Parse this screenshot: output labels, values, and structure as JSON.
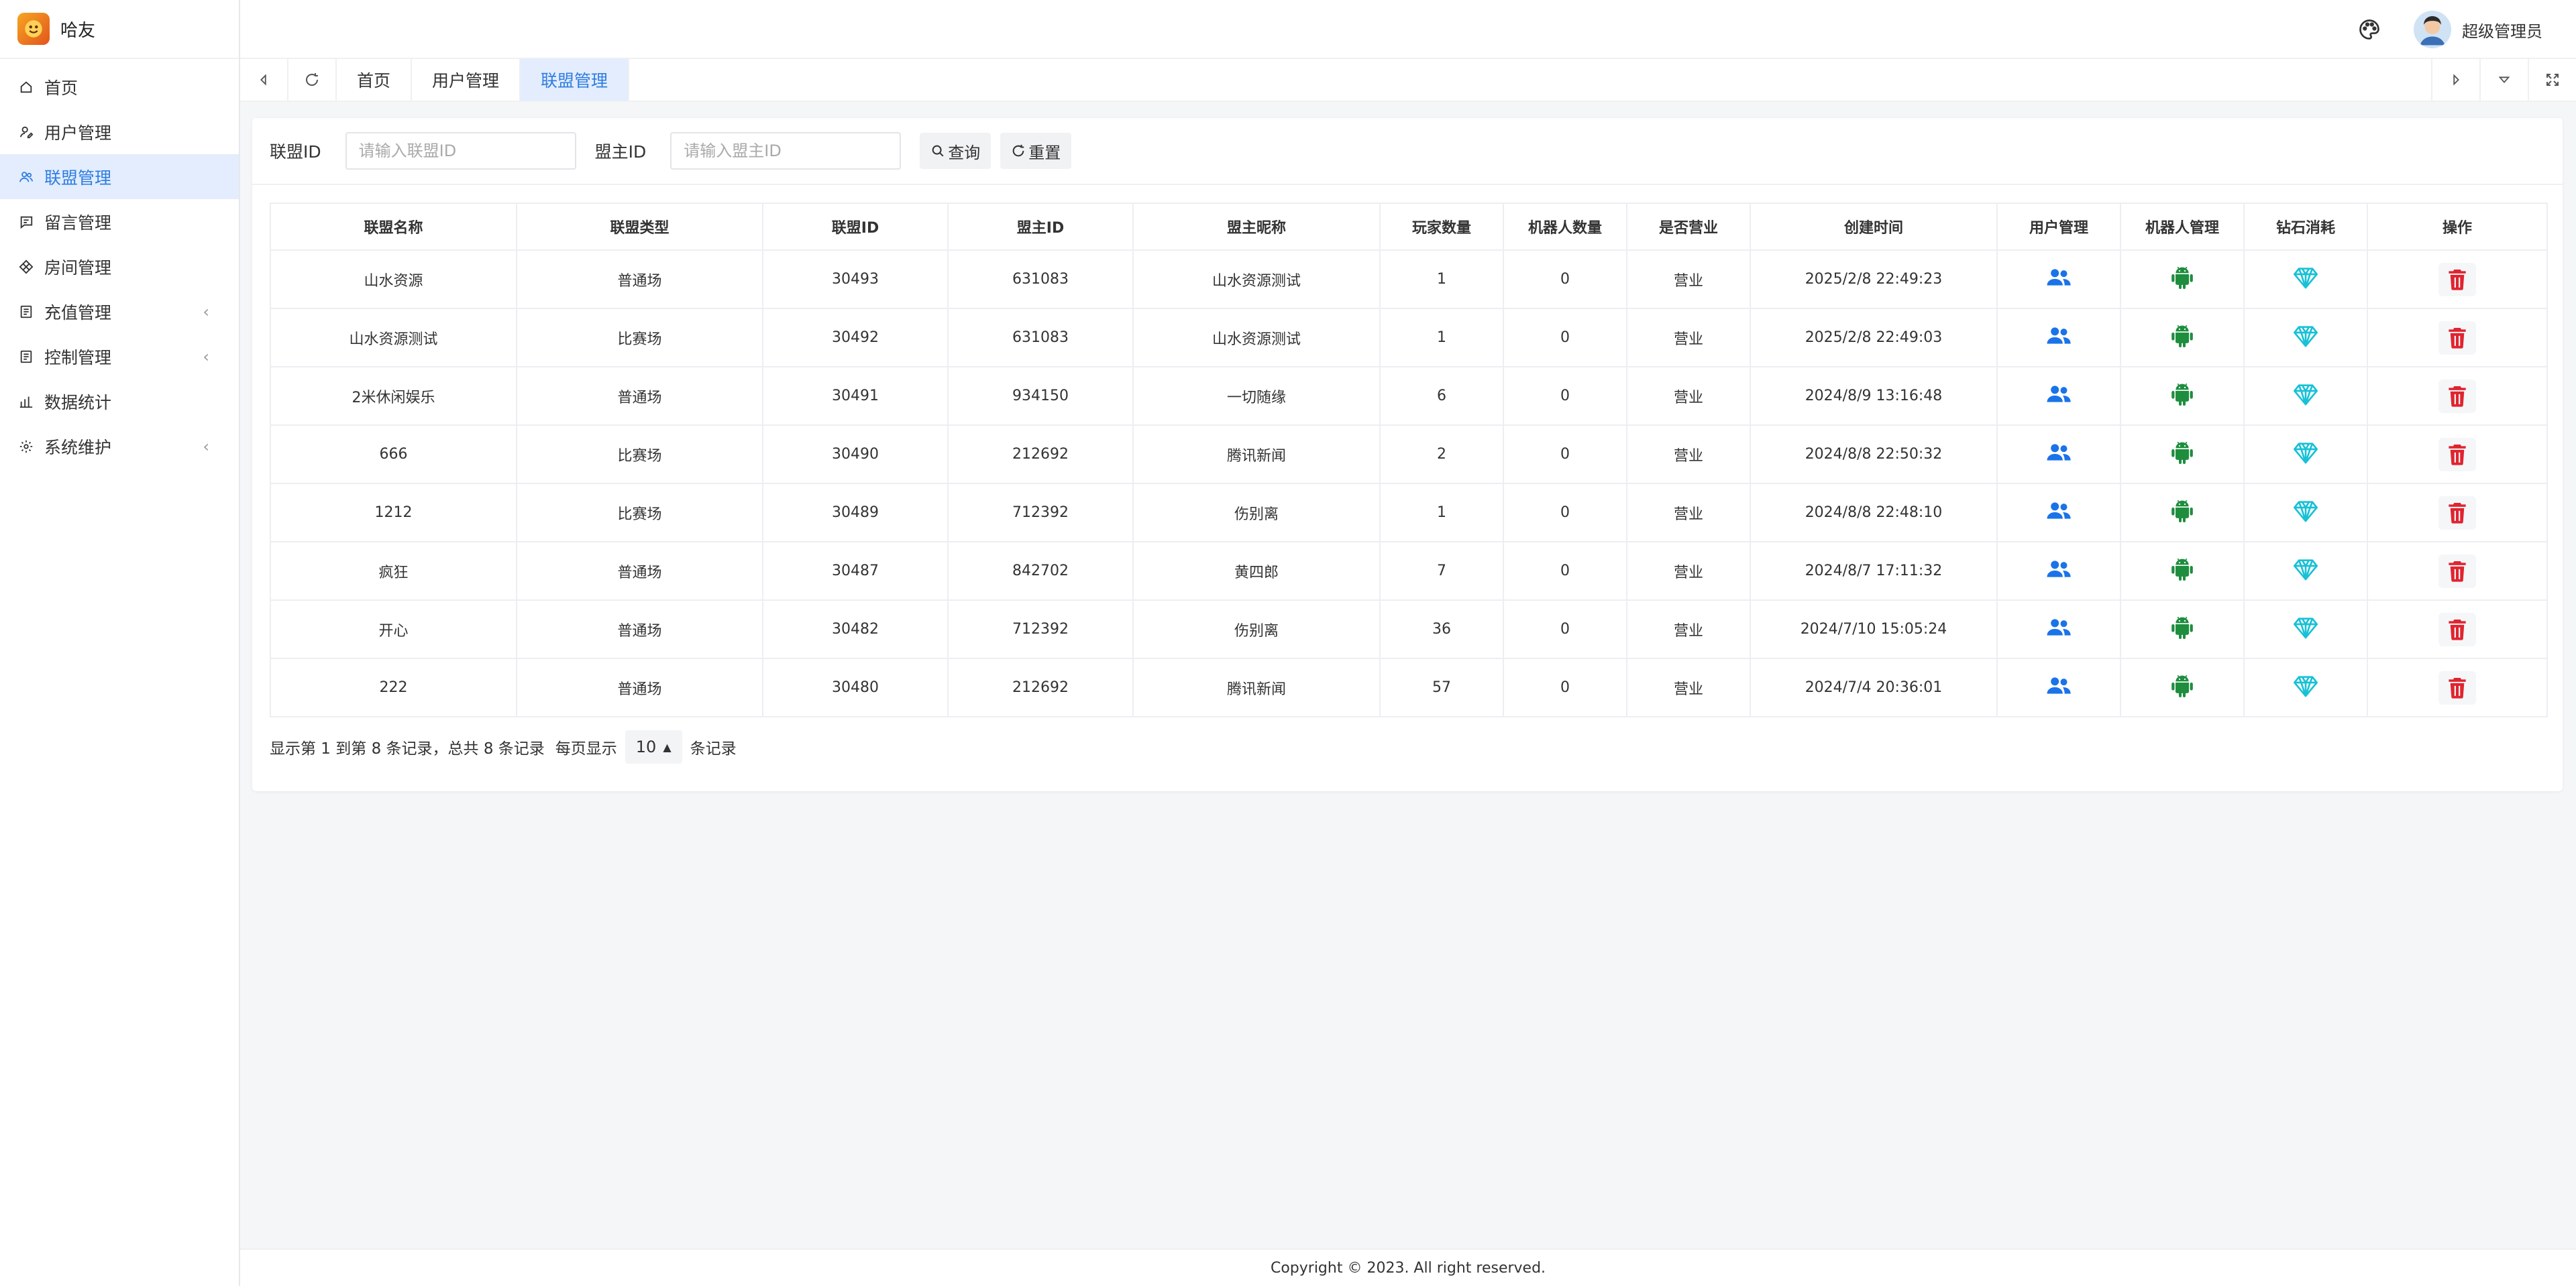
{
  "brand": {
    "name": "哈友"
  },
  "sidebar": {
    "items": [
      {
        "label": "首页",
        "icon": "home-icon",
        "expandable": false
      },
      {
        "label": "用户管理",
        "icon": "user-edit-icon",
        "expandable": false
      },
      {
        "label": "联盟管理",
        "icon": "users-icon",
        "expandable": false,
        "active": true
      },
      {
        "label": "留言管理",
        "icon": "message-icon",
        "expandable": false
      },
      {
        "label": "房间管理",
        "icon": "diamond-grid-icon",
        "expandable": false
      },
      {
        "label": "充值管理",
        "icon": "receipt-icon",
        "expandable": true
      },
      {
        "label": "控制管理",
        "icon": "receipt-icon",
        "expandable": true
      },
      {
        "label": "数据统计",
        "icon": "bar-chart-icon",
        "expandable": false
      },
      {
        "label": "系统维护",
        "icon": "gear-icon",
        "expandable": true
      }
    ],
    "caret": "‹"
  },
  "header": {
    "user_name": "超级管理员"
  },
  "tabs": [
    {
      "label": "首页"
    },
    {
      "label": "用户管理"
    },
    {
      "label": "联盟管理",
      "active": true
    }
  ],
  "search": {
    "alliance_label": "联盟ID",
    "alliance_placeholder": "请输入联盟ID",
    "owner_label": "盟主ID",
    "owner_placeholder": "请输入盟主ID",
    "query_label": "查询",
    "reset_label": "重置"
  },
  "table": {
    "headers": [
      "联盟名称",
      "联盟类型",
      "联盟ID",
      "盟主ID",
      "盟主昵称",
      "玩家数量",
      "机器人数量",
      "是否营业",
      "创建时间",
      "用户管理",
      "机器人管理",
      "钻石消耗",
      "操作"
    ],
    "rows": [
      [
        "山水资源",
        "普通场",
        "30493",
        "631083",
        "山水资源测试",
        "1",
        "0",
        "营业",
        "2025/2/8 22:49:23"
      ],
      [
        "山水资源测试",
        "比赛场",
        "30492",
        "631083",
        "山水资源测试",
        "1",
        "0",
        "营业",
        "2025/2/8 22:49:03"
      ],
      [
        "2米休闲娱乐",
        "普通场",
        "30491",
        "934150",
        "一切随缘",
        "6",
        "0",
        "营业",
        "2024/8/9 13:16:48"
      ],
      [
        "666",
        "比赛场",
        "30490",
        "212692",
        "腾讯新闻",
        "2",
        "0",
        "营业",
        "2024/8/8 22:50:32"
      ],
      [
        "1212",
        "比赛场",
        "30489",
        "712392",
        "伤别离",
        "1",
        "0",
        "营业",
        "2024/8/8 22:48:10"
      ],
      [
        "疯狂",
        "普通场",
        "30487",
        "842702",
        "黄四郎",
        "7",
        "0",
        "营业",
        "2024/8/7 17:11:32"
      ],
      [
        "开心",
        "普通场",
        "30482",
        "712392",
        "伤别离",
        "36",
        "0",
        "营业",
        "2024/7/10 15:05:24"
      ],
      [
        "222",
        "普通场",
        "30480",
        "212692",
        "腾讯新闻",
        "57",
        "0",
        "营业",
        "2024/7/4 20:36:01"
      ]
    ]
  },
  "pager": {
    "summary": "显示第 1 到第 8 条记录，总共 8 条记录",
    "per_page_prefix": "每页显示",
    "per_page_value": "10",
    "per_page_suffix": "条记录"
  },
  "footer": {
    "text": "Copyright © 2023. All right reserved."
  },
  "colors": {
    "accent": "#2f7de1",
    "active_bg": "#e3edfd",
    "users_icon": "#1a73e8",
    "android_icon": "#1e8e3e",
    "diamond_icon": "#17c1d6",
    "delete_icon": "#e0242f"
  }
}
